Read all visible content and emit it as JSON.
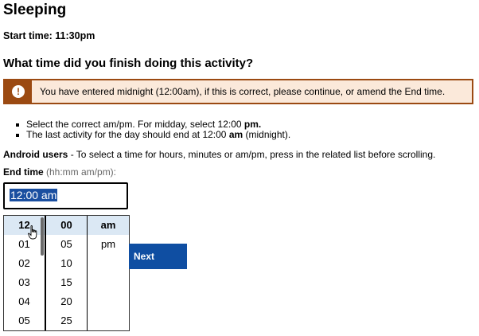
{
  "activity": {
    "title": "Sleeping",
    "start_time": "Start time: 11:30pm"
  },
  "question": "What time did you finish doing this activity?",
  "warning": {
    "icon": "exclamation-icon",
    "text": "You have entered midnight (12:00am), if this is correct, please continue, or amend the End time."
  },
  "hints": {
    "hint1_a": "Select the correct am/pm. For midday, select 12:00 ",
    "hint1_b": "pm.",
    "hint2_a": "The last activity for the day should end at 12:00 ",
    "hint2_b": "am",
    "hint2_c": " (midnight)."
  },
  "android": {
    "label": "Android users",
    "text": " - To select a time for hours, minutes or am/pm, press in the related list before scrolling."
  },
  "end_time": {
    "label": "End time",
    "format": " (hh:mm am/pm):",
    "value": "12:00 am"
  },
  "picker": {
    "hours": [
      "12",
      "01",
      "02",
      "03",
      "04",
      "05"
    ],
    "minutes": [
      "00",
      "05",
      "10",
      "15",
      "20",
      "25"
    ],
    "ampm": [
      "am",
      "pm"
    ]
  },
  "next_button": "Next",
  "colors": {
    "warning_border": "#9b4a12",
    "warning_bg": "#fbe9da",
    "button_bg": "#0f4ea2",
    "selection_bg": "#1a4fa0",
    "picker_selected_bg": "#dbe8f4"
  }
}
